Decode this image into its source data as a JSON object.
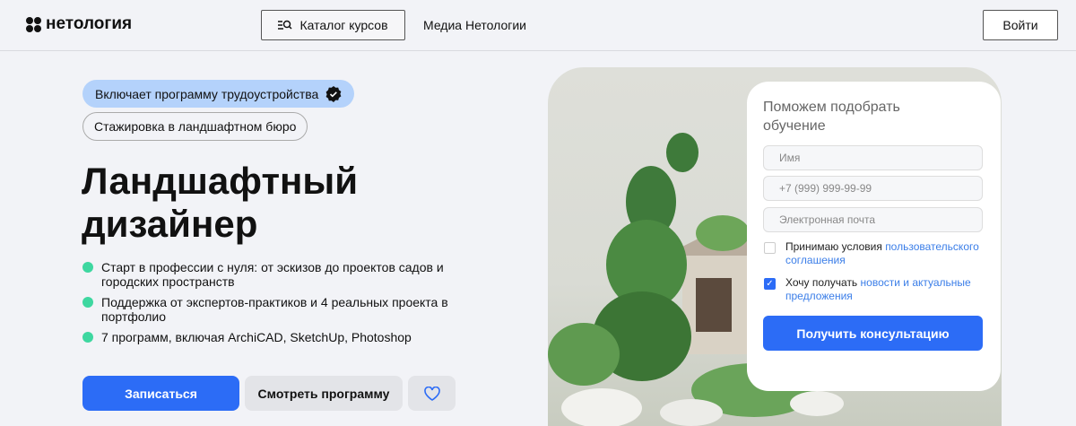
{
  "header": {
    "logo": "нетология",
    "catalog": "Каталог курсов",
    "media": "Медиа Нетологии",
    "login": "Войти"
  },
  "hero": {
    "badge_employment": "Включает программу трудоустройства",
    "badge_internship": "Стажировка в ландшафтном бюро",
    "title": "Ландшафтный дизайнер",
    "bullets": [
      "Старт в профессии с нуля: от эскизов до проектов садов и городских пространств",
      "Поддержка от экспертов-практиков и 4 реальных проекта в портфолио",
      "7 программ, включая ArchiCAD, SketchUp, Photoshop"
    ],
    "enroll": "Записаться",
    "program": "Смотреть программу"
  },
  "form": {
    "title": "Поможем подобрать обучение",
    "name_placeholder": "Имя",
    "phone_placeholder": "+7 (999) 999-99-99",
    "email_placeholder": "Электронная почта",
    "agree_text": "Принимаю условия ",
    "agree_link": "пользовательского соглашения",
    "agree_checked": false,
    "news_text": "Хочу получать ",
    "news_link": "новости и актуальные предложения",
    "news_checked": true,
    "submit": "Получить консультацию"
  },
  "colors": {
    "accent": "#2c6cf6",
    "bullet": "#3ed7a0",
    "badge": "#b4d2fb"
  }
}
